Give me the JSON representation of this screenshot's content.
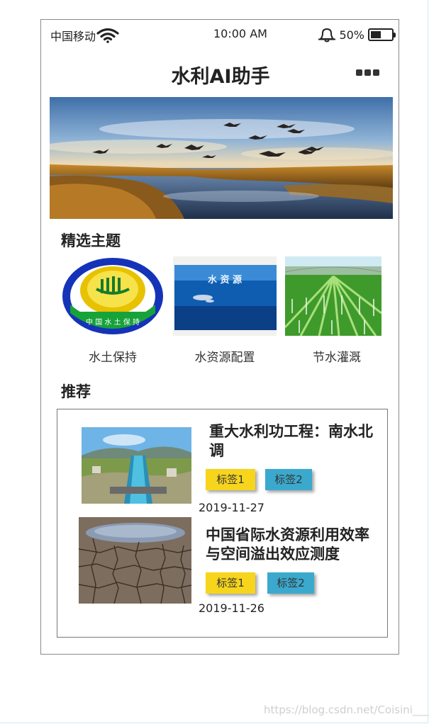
{
  "status_bar": {
    "carrier": "中国移动",
    "time": "10:00 AM",
    "battery_percent": "50%",
    "battery_level": 0.5
  },
  "header": {
    "title": "水利AI助手",
    "more_icon": "more-dots-icon"
  },
  "banner": {
    "image": "wetland-sunset-with-cranes"
  },
  "featured": {
    "heading": "精选主题",
    "items": [
      {
        "label": "水土保持",
        "image": "soil-conservation-logo",
        "logo_text": "中 国 水 土 保 持"
      },
      {
        "label": "水资源配置",
        "image": "water-resources-ocean",
        "overlay_text": "水 资 源"
      },
      {
        "label": "节水灌溉",
        "image": "irrigated-farm-field"
      }
    ]
  },
  "recommend": {
    "heading": "推荐",
    "articles": [
      {
        "title": "重大水利功工程：南水北调",
        "image": "south-north-water-canal",
        "tags": [
          "标签1",
          "标签2"
        ],
        "date": "2019-11-27"
      },
      {
        "title": "中国省际水资源利用效率与空间溢出效应测度",
        "image": "cracked-dry-earth",
        "tags": [
          "标签1",
          "标签2"
        ],
        "date": "2019-11-26"
      }
    ]
  },
  "colors": {
    "tag_yellow": "#f7d51d",
    "tag_blue": "#3ba9cd"
  },
  "watermark": "https://blog.csdn.net/Coisini___"
}
